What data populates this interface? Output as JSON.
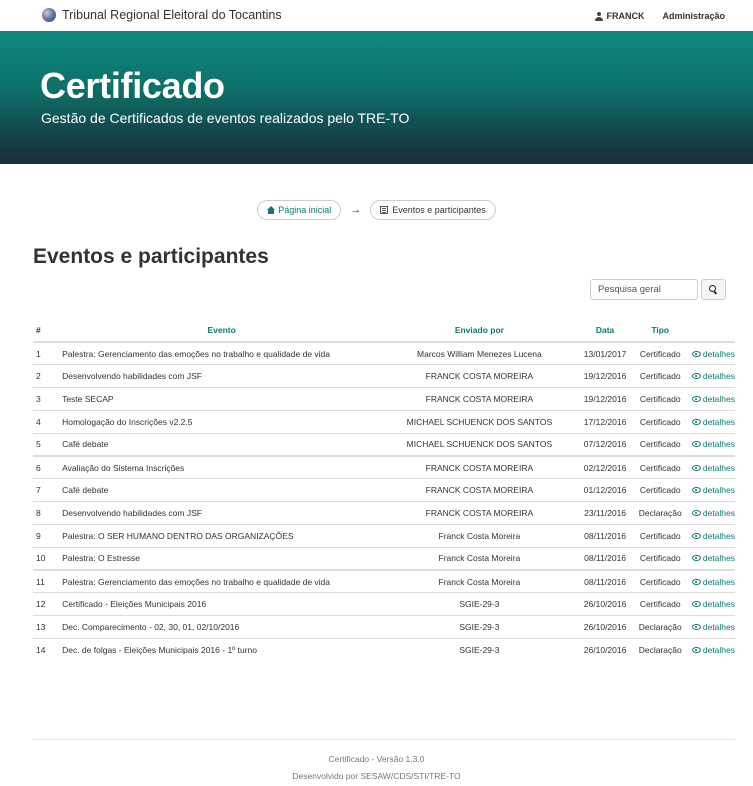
{
  "navbar": {
    "brand": "Tribunal Regional Eleitoral do Tocantins",
    "brand_icon": "tre-logo-icon",
    "user": "FRANCK",
    "user_icon": "user-icon",
    "admin": "Administração"
  },
  "hero": {
    "title": "Certificado",
    "subtitle": "Gestão de Certificados de eventos realizados pelo TRE-TO",
    "gradient_top": "#0e8a7e",
    "gradient_bottom": "#1b2e36"
  },
  "breadcrumb": {
    "home": "Página inicial",
    "home_icon": "home-icon",
    "arrow": "→",
    "current": "Eventos e participantes",
    "current_icon": "list-icon"
  },
  "page": {
    "title": "Eventos e participantes"
  },
  "search": {
    "placeholder": "Pesquisa geral",
    "button_icon": "search-icon"
  },
  "table": {
    "headers": {
      "num": "#",
      "event": "Evento",
      "sent_by": "Enviado por",
      "date": "Data",
      "type": "Tipo"
    },
    "detail_label": "detalhes",
    "detail_icon": "eye-icon",
    "rows": [
      {
        "num": "1",
        "event": "Palestra: Gerenciamento das emoções no trabalho e qualidade de vida",
        "sent_by": "Marcos William Menezes Lucena",
        "date": "13/01/2017",
        "type": "Certificado"
      },
      {
        "num": "2",
        "event": "Desenvolvendo habilidades com JSF",
        "sent_by": "FRANCK COSTA MOREIRA",
        "date": "19/12/2016",
        "type": "Certificado"
      },
      {
        "num": "3",
        "event": "Teste SECAP",
        "sent_by": "FRANCK COSTA MOREIRA",
        "date": "19/12/2016",
        "type": "Certificado"
      },
      {
        "num": "4",
        "event": "Homologação do Inscrições v2.2.5",
        "sent_by": "MICHAEL SCHUENCK DOS SANTOS",
        "date": "17/12/2016",
        "type": "Certificado"
      },
      {
        "num": "5",
        "event": "Café debate",
        "sent_by": "MICHAEL SCHUENCK DOS SANTOS",
        "date": "07/12/2016",
        "type": "Certificado"
      },
      {
        "num": "6",
        "event": "Avaliação do Sistema Inscrições",
        "sent_by": "FRANCK COSTA MOREIRA",
        "date": "02/12/2016",
        "type": "Certificado"
      },
      {
        "num": "7",
        "event": "Café debate",
        "sent_by": "FRANCK COSTA MOREIRA",
        "date": "01/12/2016",
        "type": "Certificado"
      },
      {
        "num": "8",
        "event": "Desenvolvendo habilidades com JSF",
        "sent_by": "FRANCK COSTA MOREIRA",
        "date": "23/11/2016",
        "type": "Declaração"
      },
      {
        "num": "9",
        "event": "Palestra: O SER HUMANO DENTRO DAS ORGANIZAÇÕES",
        "sent_by": "Franck Costa Moreira",
        "date": "08/11/2016",
        "type": "Certificado"
      },
      {
        "num": "10",
        "event": "Palestra: O Estresse",
        "sent_by": "Franck Costa Moreira",
        "date": "08/11/2016",
        "type": "Certificado"
      },
      {
        "num": "11",
        "event": "Palestra: Gerenciamento das emoções no trabalho e qualidade de vida",
        "sent_by": "Franck Costa Moreira",
        "date": "08/11/2016",
        "type": "Certificado"
      },
      {
        "num": "12",
        "event": "Certificado - Eleições Municipais 2016",
        "sent_by": "SGIE-29-3",
        "date": "26/10/2016",
        "type": "Certificado"
      },
      {
        "num": "13",
        "event": "Dec. Comparecimento - 02, 30, 01, 02/10/2016",
        "sent_by": "SGIE-29-3",
        "date": "26/10/2016",
        "type": "Declaração"
      },
      {
        "num": "14",
        "event": "Dec. de folgas - Eleições Municipais 2016 - 1º turno",
        "sent_by": "SGIE-29-3",
        "date": "26/10/2016",
        "type": "Declaração"
      }
    ]
  },
  "footer": {
    "version": "Certificado - Versão 1.3.0",
    "credits": "Desenvolvido por SESAW/CDS/STI/TRE-TO"
  },
  "colors": {
    "accent": "#0e7a70",
    "border": "#dddddd"
  }
}
